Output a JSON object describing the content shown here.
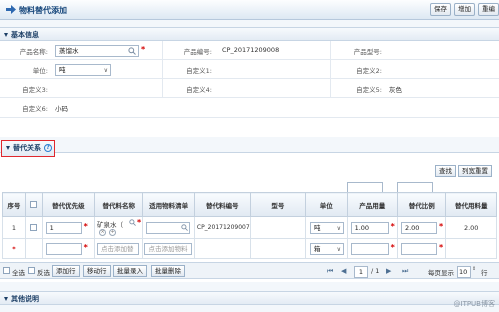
{
  "title": "物料替代添加",
  "toolbar": {
    "save": "保存",
    "add": "增加",
    "reset": "重编"
  },
  "basic": {
    "section_title": "基本信息",
    "product_name_label": "产品名称:",
    "product_name_value": "蒸馏水",
    "product_code_label": "产品编号:",
    "product_code_value": "CP_20171209008",
    "product_model_label": "产品型号:",
    "unit_label": "单位:",
    "unit_value": "吨",
    "custom1_label": "自定义1:",
    "custom2_label": "自定义2:",
    "custom3_label": "自定义3:",
    "custom4_label": "自定义4:",
    "custom5_label": "自定义5:",
    "custom5_value": "灰色",
    "custom6_label": "自定义6:",
    "custom6_value": "小码"
  },
  "replace": {
    "section_title": "替代关系",
    "help": "?",
    "find_btn": "查找",
    "reset_col_btn": "列宽重置"
  },
  "grid": {
    "headers": [
      "序号",
      "",
      "替代优先级",
      "替代料名称",
      "适用物料清单",
      "替代料编号",
      "型号",
      "单位",
      "产品用量",
      "替代比例",
      "替代用料量"
    ],
    "row1": {
      "index": "1",
      "priority": "1",
      "name": "矿泉水（",
      "code": "CP_20171209007",
      "unit": "吨",
      "qty": "1.00",
      "ratio": "2.00",
      "use_qty": "2.00"
    },
    "row2": {
      "index": "*",
      "name_placeholder": "点击添加替",
      "bom_placeholder": "点击添加物料",
      "unit": "箱"
    }
  },
  "footer": {
    "select_all": "全选",
    "invert": "反选",
    "add_row": "添加行",
    "move_row": "移动行",
    "batch_import": "批量录入",
    "batch_delete": "批量删除",
    "page_current": "1",
    "page_total": "/ 1",
    "per_page_label": "每页显示",
    "per_page_value": "10",
    "per_page_suffix": "行"
  },
  "other": {
    "section_title": "其他说明"
  },
  "watermark": "@ITPUB博客"
}
